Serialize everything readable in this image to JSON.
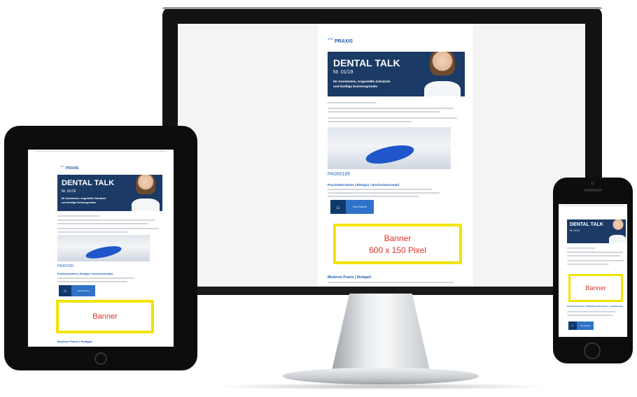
{
  "newsletter": {
    "logo_text": "PRAXIS",
    "title": "DENTAL TALK",
    "issue": "Nr. 01/19",
    "tagline_1": "für Assistenten, Angestellte Zahnärzte",
    "tagline_2": "und künftige Existenzgründer",
    "listing_id": "PA000185",
    "listing_title": "Praxisübernahme | Bietigheim-Bissingen / Ludwigsburg",
    "listing_title_tablet": "Praxisübernahme | Bietigau / Hochschwarzwald",
    "listing_title_monitor": "Praxisübernahme | Bietigau / Hochschwarzwald",
    "button_label": "Zum Exposé",
    "next_title": "Moderne Praxis | Stuttgart",
    "banner_tablet": "Banner",
    "banner_phone": "Banner",
    "banner_monitor_1": "Banner",
    "banner_monitor_2": "600 x 150 Pixel"
  },
  "colors": {
    "hero": "#1b3a66",
    "banner_border": "#f3e300",
    "banner_text": "#e0312a",
    "link": "#2a6fc4"
  }
}
